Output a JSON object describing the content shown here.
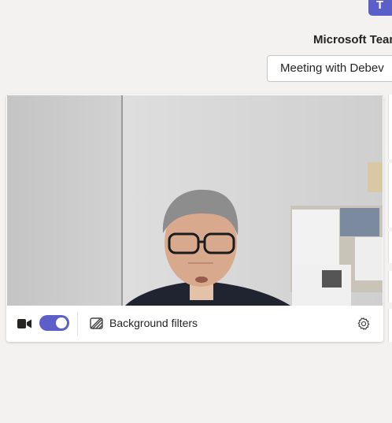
{
  "app": {
    "title": "Microsoft Teams"
  },
  "meeting": {
    "title_value": "Meeting with Debev"
  },
  "controls": {
    "camera_enabled": true,
    "background_filters_label": "Background filters"
  },
  "colors": {
    "accent": "#5b5fc7",
    "page_background": "#f3f2f1",
    "panel_background": "#ffffff"
  },
  "icons": [
    "teams-logo",
    "video-camera-icon",
    "background-filters-icon",
    "gear-icon"
  ]
}
